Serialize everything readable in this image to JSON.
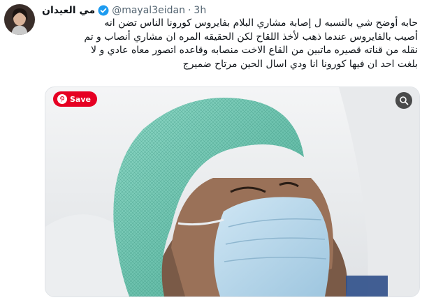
{
  "tweet": {
    "author": {
      "display_name": "مي العيدان",
      "handle": "@mayal3eidan",
      "verified": true,
      "avatar_icon": "profile-avatar"
    },
    "separator": "·",
    "timestamp": "3h",
    "text_lines": [
      "حابه أوضح شي بالنسبه ل إصابة مشاري البلام بفايروس كورونا الناس تضن انه",
      "أصيب بالفايروس عندما ذهب لأخذ اللقاح لكن الحقيقه المره ان مشاري أنصاب و تم",
      "نقله من قناته قصيره ماتبين من القاع الاخت منصابه وقاعده اتصور معاه عادي و لا",
      "بلغت احد ان فيها كورونا انا ودي اسال الحين مرتاح ضميرج"
    ],
    "media": {
      "save_label": "Save",
      "save_icon": "pinterest-icon",
      "zoom_icon": "lens-icon"
    }
  },
  "colors": {
    "accent": "#1d9bf0",
    "save_red": "#e60023",
    "secondary_text": "#536471"
  }
}
